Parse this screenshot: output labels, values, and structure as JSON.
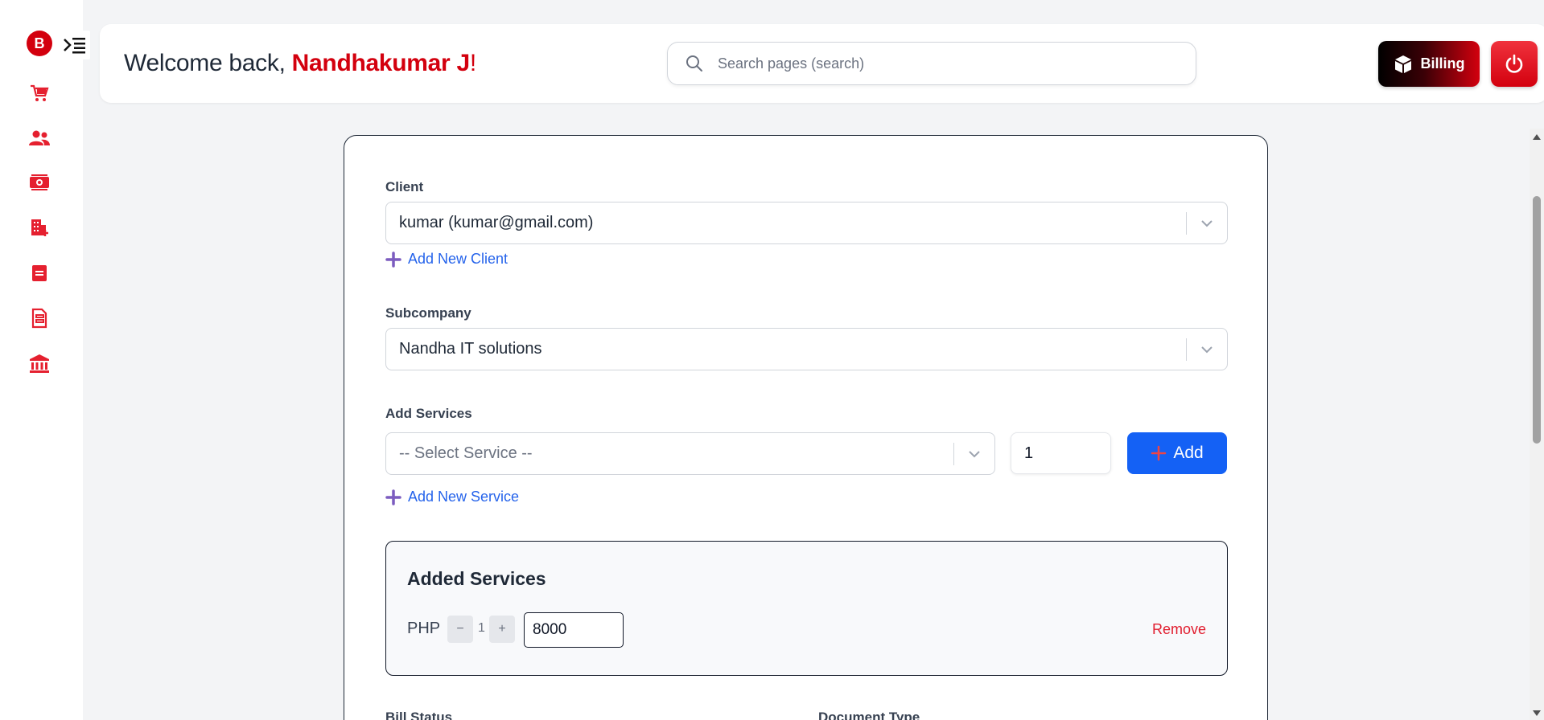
{
  "sidebar": {
    "logo_letter": "B",
    "icons": [
      "cart-icon",
      "users-icon",
      "money-icon",
      "building-icon",
      "document-icon",
      "invoice-icon",
      "bank-icon"
    ]
  },
  "header": {
    "welcome_prefix": "Welcome back, ",
    "user_name": "Nandhakumar J",
    "welcome_suffix": "!",
    "search_placeholder": "Search pages (search)",
    "billing_label": "Billing"
  },
  "form": {
    "client_label": "Client",
    "client_value": "kumar (kumar@gmail.com)",
    "add_client_label": "Add New Client",
    "subcompany_label": "Subcompany",
    "subcompany_value": "Nandha IT solutions",
    "services_label": "Add Services",
    "service_placeholder": "-- Select Service --",
    "quantity": "1",
    "add_button_label": "Add",
    "add_service_label": "Add New Service",
    "added_services_title": "Added Services",
    "added_services": [
      {
        "name": "PHP",
        "quantity": "1",
        "price": "8000",
        "remove_label": "Remove"
      }
    ],
    "bill_status_label": "Bill Status",
    "document_type_label": "Document Type"
  },
  "colors": {
    "accent_red": "#d3000e",
    "primary_blue": "#1461f5",
    "link_blue": "#2563eb",
    "plus_purple": "#7c5cbf"
  }
}
